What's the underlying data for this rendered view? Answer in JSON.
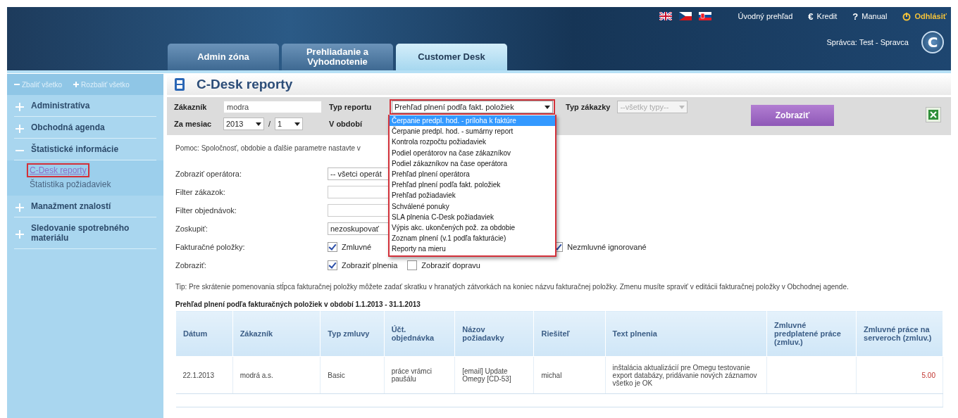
{
  "header": {
    "links": [
      {
        "kind": "home",
        "label": "Úvodný prehľad"
      },
      {
        "kind": "credit",
        "icon": "€",
        "label": "Kredit"
      },
      {
        "kind": "manual",
        "icon": "?",
        "label": "Manual"
      },
      {
        "kind": "logout",
        "label": "Odhlásiť"
      }
    ],
    "tabs": [
      {
        "label": "Admin zóna",
        "selected": false
      },
      {
        "label": "Prehliadanie a Vyhodnotenie",
        "selected": false
      },
      {
        "label": "Customer Desk",
        "selected": true
      }
    ],
    "user": "Správca: Test - Spravca",
    "logo": "C"
  },
  "sidebar": {
    "tools": [
      {
        "kind": "collapse",
        "label": "Zbaliť všetko"
      },
      {
        "kind": "expand",
        "label": "Rozbaliť všetko"
      }
    ],
    "items": [
      {
        "label": "Administratíva",
        "expanded": false
      },
      {
        "label": "Obchodná agenda",
        "expanded": false
      },
      {
        "label": "Štatistické informácie",
        "expanded": true,
        "children": [
          {
            "label": "C-Desk reporty",
            "selected": true
          },
          {
            "label": "Štatistika požiadaviek",
            "selected": false
          }
        ]
      },
      {
        "label": "Manažment znalostí",
        "expanded": false
      },
      {
        "label": "Sledovanie spotrebného materiálu",
        "expanded": false
      }
    ]
  },
  "page": {
    "title": "C-Desk reporty",
    "filters": {
      "customer_label": "Zákazník",
      "customer_value": "modra",
      "report_label": "Typ reportu",
      "report_value": "Prehľad plnení podľa fakt. položiek",
      "report_options": [
        {
          "label": "Čerpanie predpl. hod. - príloha k faktúre",
          "selected": true
        },
        {
          "label": "Čerpanie predpl. hod. - sumárny report",
          "selected": false
        },
        {
          "label": "Kontrola rozpočtu požiadaviek",
          "selected": false
        },
        {
          "label": "Podiel operátorov na čase zákazníkov",
          "selected": false
        },
        {
          "label": "Podiel zákazníkov na čase operátora",
          "selected": false
        },
        {
          "label": "Prehľad plnení operátora",
          "selected": false
        },
        {
          "label": "Prehľad plnení podľa fakt. položiek",
          "selected": false
        },
        {
          "label": "Prehľad požiadaviek",
          "selected": false
        },
        {
          "label": "Schválené ponuky",
          "selected": false
        },
        {
          "label": "SLA plnenia C-Desk požiadaviek",
          "selected": false
        },
        {
          "label": "Výpis akc. ukončených pož. za obdobie",
          "selected": false
        },
        {
          "label": "Zoznam plnení (v.1 podľa fakturácie)",
          "selected": false
        },
        {
          "label": "Reporty na mieru",
          "selected": false
        }
      ],
      "order_type_label": "Typ zákazky",
      "order_type_value": "--všetky typy--",
      "order_type_disabled": true,
      "month_label": "Za mesiac",
      "year": "2013",
      "separator": "/",
      "month": "1",
      "period_label": "V období",
      "submit": "Zobraziť"
    },
    "help": "Pomoc: Spoločnosť, obdobie a ďalšie parametre nastavte v",
    "form": [
      {
        "kind": "select",
        "label": "Zobraziť operátora:",
        "value": "-- všetci operát"
      },
      {
        "kind": "input",
        "label": "Filter zákazok:"
      },
      {
        "kind": "input",
        "label": "Filter objednávok:"
      },
      {
        "kind": "select",
        "label": "Zoskupiť:",
        "value": "nezoskupovať"
      },
      {
        "kind": "checks",
        "label": "Fakturačné položky:",
        "options": [
          {
            "label": "Zmluvné",
            "checked": true
          },
          {
            "label": "Nezmluvné ignorované",
            "checked": true
          }
        ]
      },
      {
        "kind": "checks",
        "label": "Zobraziť:",
        "options": [
          {
            "label": "Zobraziť plnenia",
            "checked": true
          },
          {
            "label": "Zobraziť dopravu",
            "checked": false
          }
        ]
      }
    ],
    "tip": "Tip: Pre skrátenie pomenovania stĺpca fakturačnej položky môžete zadať skratku v hranatých zátvorkách na koniec názvu fakturačnej položky. Zmenu musíte spraviť v editácii fakturačnej položky v Obchodnej agende.",
    "table": {
      "title": "Prehľad plnení podľa fakturačných položiek v období  1.1.2013 - 31.1.2013",
      "columns": [
        "Dátum",
        "Zákazník",
        "Typ zmluvy",
        "Účt. objednávka",
        "Názov požiadavky",
        "Riešiteľ",
        "Text plnenia",
        "Zmluvné predplatené práce (zmluv.)",
        "Zmluvné práce na serveroch (zmluv.)"
      ],
      "rows": [
        [
          "22.1.2013",
          "modrá a.s.",
          "Basic",
          "práce vrámci paušálu",
          "[email] Update Omegy [CD-53]",
          "michal",
          "inštalácia aktualizácií pre Omegu testovanie export databázy, pridávanie nových záznamov všetko je OK",
          "",
          "5.00"
        ]
      ]
    }
  }
}
